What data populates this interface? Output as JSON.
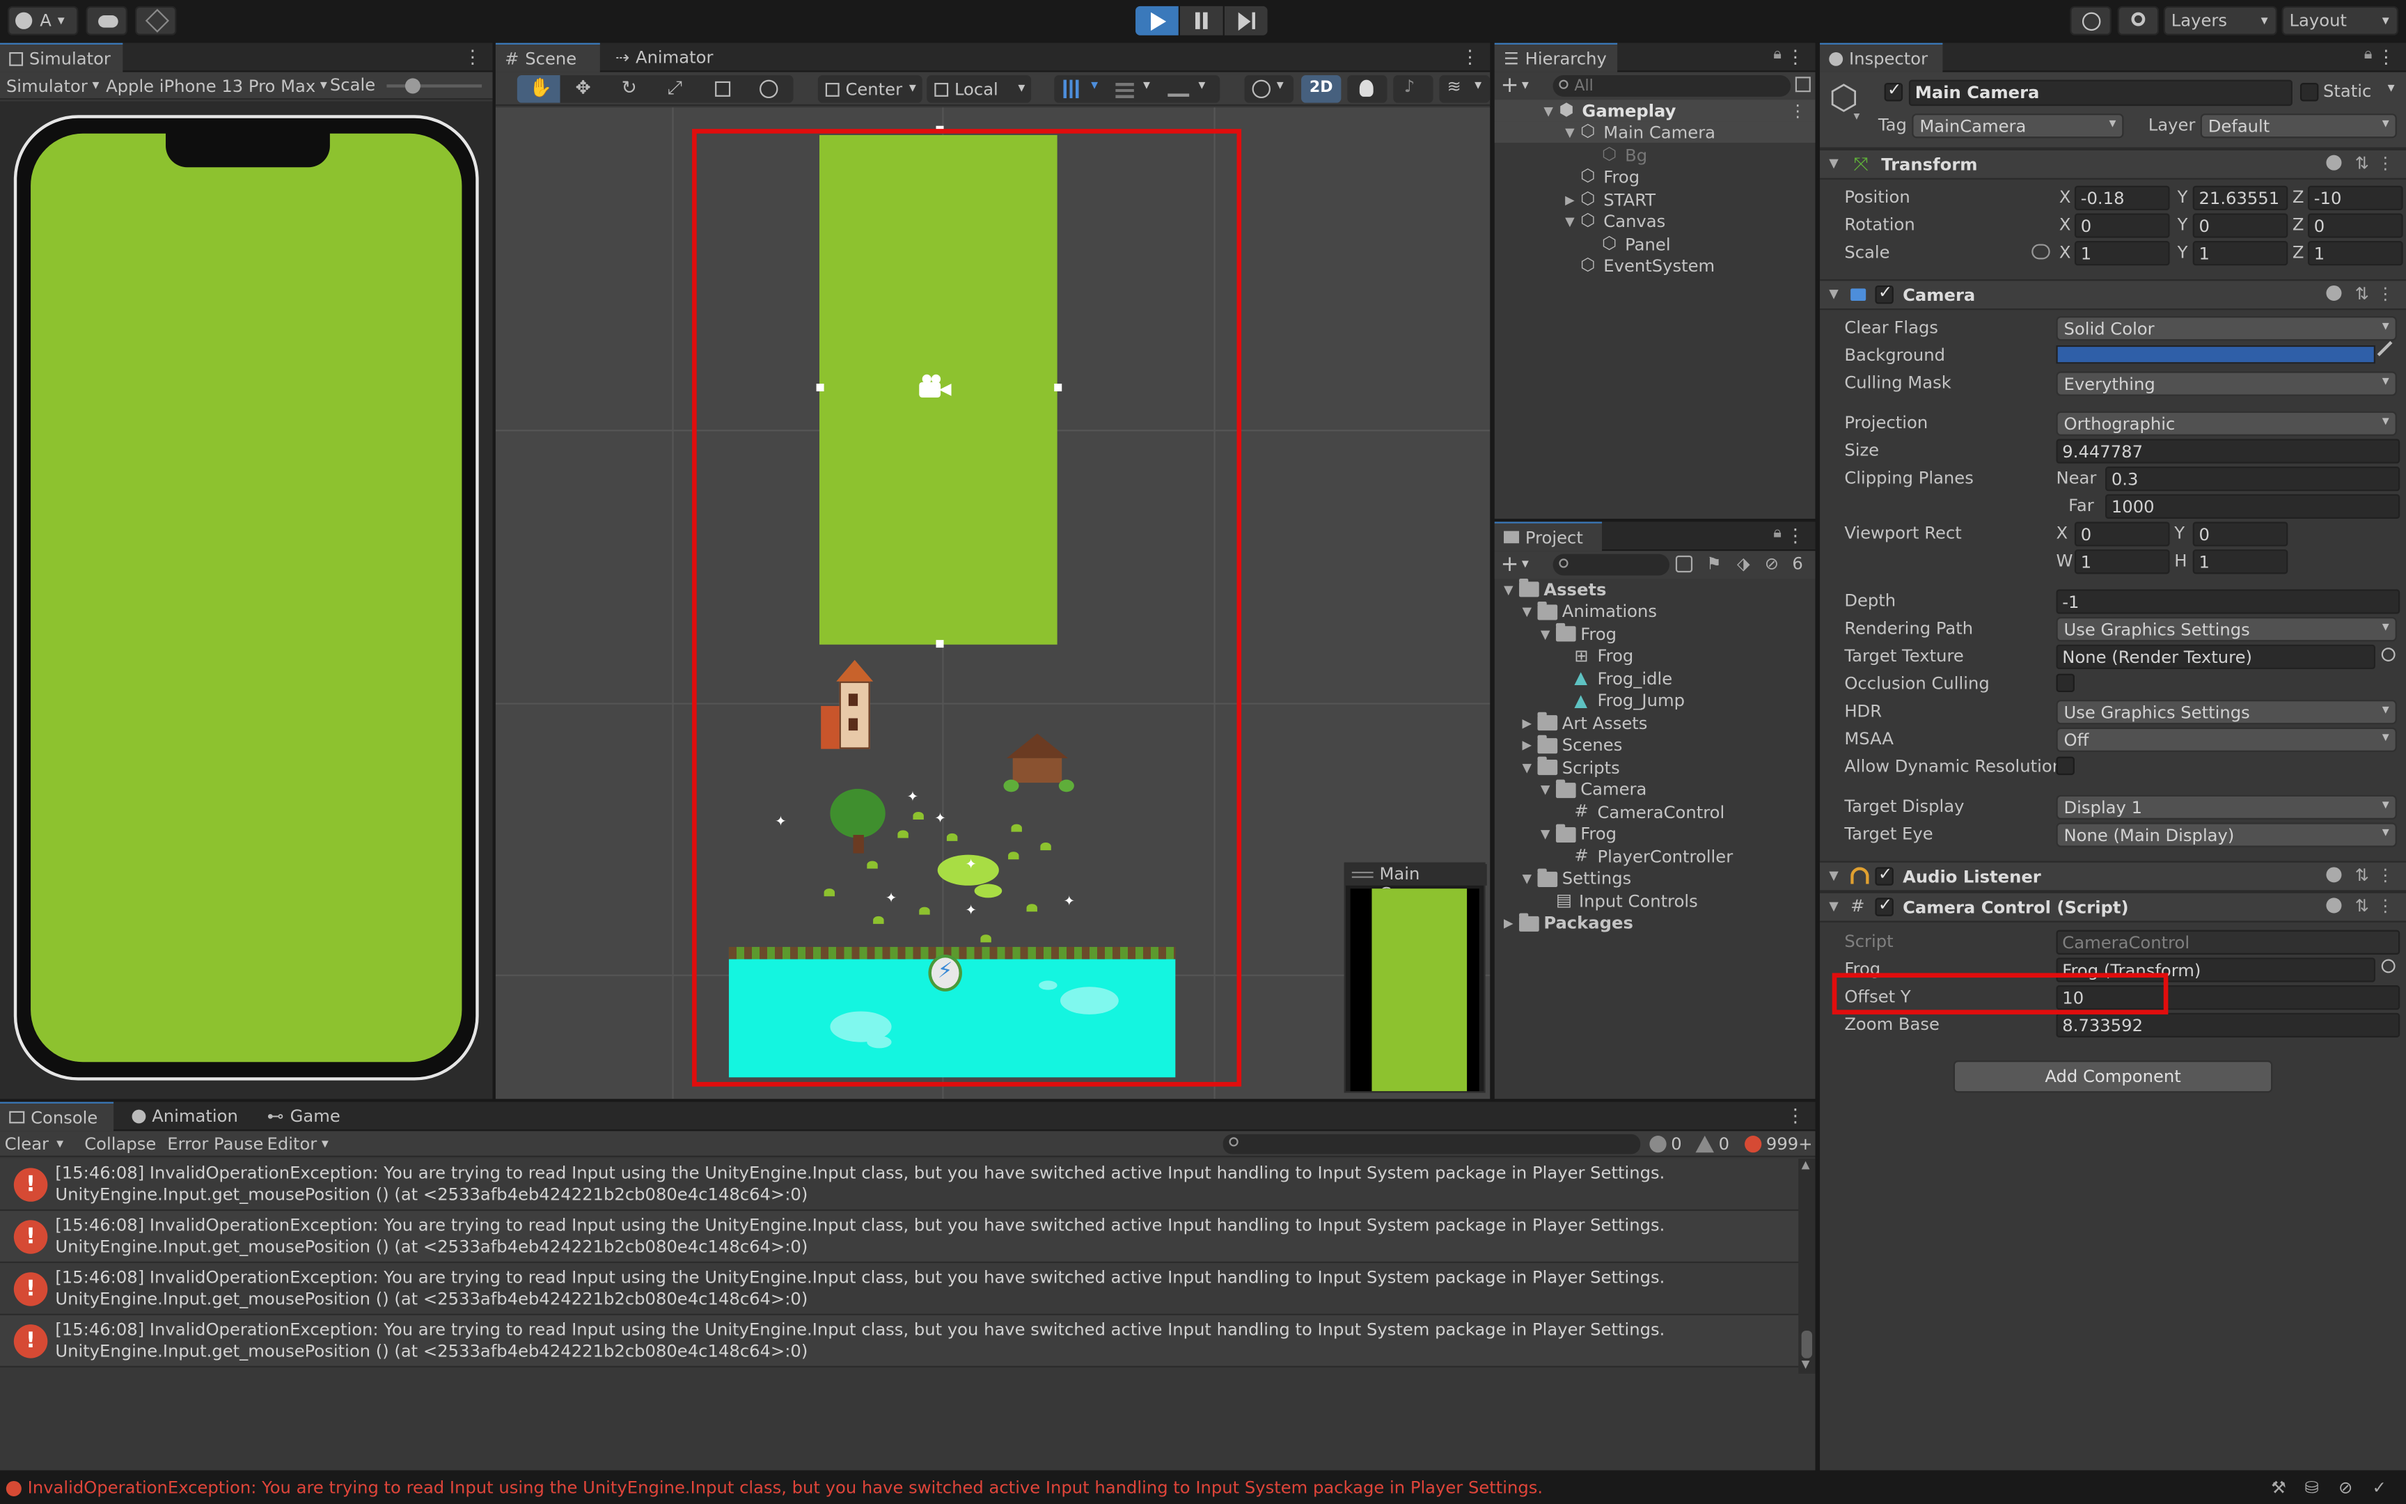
{
  "toolbar": {
    "account_label": "A",
    "layers_label": "Layers",
    "layout_label": "Layout",
    "colors": {
      "play_active": "#3a79bb"
    }
  },
  "simulator": {
    "tab_label": "Simulator",
    "mode_dropdown": "Simulator",
    "device_dropdown": "Apple iPhone 13 Pro Max",
    "scale_label": "Scale",
    "screen_color": "#8dc22f"
  },
  "scene": {
    "tabs": [
      "Scene",
      "Animator"
    ],
    "pivot_dropdown": "Center",
    "space_dropdown": "Local",
    "mode_2d_label": "2D",
    "camera_preview_title": "Main Camera"
  },
  "hierarchy": {
    "tab_label": "Hierarchy",
    "search_placeholder": "All",
    "items": [
      {
        "label": "Gameplay",
        "depth": 0,
        "expanded": true
      },
      {
        "label": "Main Camera",
        "depth": 1,
        "expanded": true,
        "selected": true
      },
      {
        "label": "Bg",
        "depth": 2,
        "disabled": true
      },
      {
        "label": "Frog",
        "depth": 1
      },
      {
        "label": "START",
        "depth": 1,
        "collapsed": true
      },
      {
        "label": "Canvas",
        "depth": 1,
        "expanded": true
      },
      {
        "label": "Panel",
        "depth": 2
      },
      {
        "label": "EventSystem",
        "depth": 1
      }
    ]
  },
  "project": {
    "tab_label": "Project",
    "hidden_count": "6",
    "items": [
      {
        "label": "Assets",
        "depth": 0,
        "type": "folder",
        "expanded": true,
        "bold": true
      },
      {
        "label": "Animations",
        "depth": 1,
        "type": "folder",
        "expanded": true
      },
      {
        "label": "Frog",
        "depth": 2,
        "type": "folder",
        "expanded": true
      },
      {
        "label": "Frog",
        "depth": 3,
        "type": "controller"
      },
      {
        "label": "Frog_idle",
        "depth": 3,
        "type": "anim"
      },
      {
        "label": "Frog_Jump",
        "depth": 3,
        "type": "anim"
      },
      {
        "label": "Art Assets",
        "depth": 1,
        "type": "folder"
      },
      {
        "label": "Scenes",
        "depth": 1,
        "type": "folder"
      },
      {
        "label": "Scripts",
        "depth": 1,
        "type": "folder",
        "expanded": true
      },
      {
        "label": "Camera",
        "depth": 2,
        "type": "folder",
        "expanded": true
      },
      {
        "label": "CameraControl",
        "depth": 3,
        "type": "script"
      },
      {
        "label": "Frog",
        "depth": 2,
        "type": "folder",
        "expanded": true
      },
      {
        "label": "PlayerController",
        "depth": 3,
        "type": "script"
      },
      {
        "label": "Settings",
        "depth": 1,
        "type": "folder",
        "expanded": true
      },
      {
        "label": "Input Controls",
        "depth": 2,
        "type": "asset"
      },
      {
        "label": "Packages",
        "depth": 0,
        "type": "folder",
        "bold": true
      }
    ]
  },
  "inspector": {
    "tab_label": "Inspector",
    "object_name": "Main Camera",
    "static_label": "Static",
    "tag_label": "Tag",
    "tag_value": "MainCamera",
    "layer_label": "Layer",
    "layer_value": "Default",
    "transform": {
      "title": "Transform",
      "position_label": "Position",
      "rotation_label": "Rotation",
      "scale_label": "Scale",
      "position": {
        "x": "-0.18",
        "y": "21.63551",
        "z": "-10"
      },
      "rotation": {
        "x": "0",
        "y": "0",
        "z": "0"
      },
      "scale": {
        "x": "1",
        "y": "1",
        "z": "1"
      }
    },
    "axes": {
      "x": "X",
      "y": "Y",
      "z": "Z",
      "w": "W",
      "h": "H"
    },
    "camera": {
      "title": "Camera",
      "clear_flags_label": "Clear Flags",
      "clear_flags": "Solid Color",
      "background_label": "Background",
      "background_color": "#2f5fa8",
      "culling_mask_label": "Culling Mask",
      "culling_mask": "Everything",
      "projection_label": "Projection",
      "projection": "Orthographic",
      "size_label": "Size",
      "size": "9.447787",
      "clipping_label": "Clipping Planes",
      "near_label": "Near",
      "near": "0.3",
      "far_label": "Far",
      "far": "1000",
      "viewport_label": "Viewport Rect",
      "viewport": {
        "x": "0",
        "y": "0",
        "w": "1",
        "h": "1"
      },
      "depth_label": "Depth",
      "depth": "-1",
      "rendering_path_label": "Rendering Path",
      "rendering_path": "Use Graphics Settings",
      "target_texture_label": "Target Texture",
      "target_texture": "None (Render Texture)",
      "occlusion_label": "Occlusion Culling",
      "hdr_label": "HDR",
      "hdr": "Use Graphics Settings",
      "msaa_label": "MSAA",
      "msaa": "Off",
      "dynres_label": "Allow Dynamic Resolution",
      "target_display_label": "Target Display",
      "target_display": "Display 1",
      "target_eye_label": "Target Eye",
      "target_eye": "None (Main Display)"
    },
    "audio_listener": {
      "title": "Audio Listener"
    },
    "camera_control": {
      "title": "Camera Control (Script)",
      "script_label": "Script",
      "script_value": "CameraControl",
      "frog_label": "Frog",
      "frog_value": "Frog (Transform)",
      "offset_y_label": "Offset Y",
      "offset_y": "10",
      "zoom_base_label": "Zoom Base",
      "zoom_base": "8.733592"
    },
    "add_component": "Add Component"
  },
  "bottom": {
    "tabs": [
      "Console",
      "Animation",
      "Game"
    ],
    "clear": "Clear",
    "collapse": "Collapse",
    "error_pause": "Error Pause",
    "editor": "Editor",
    "counts": {
      "log": "0",
      "warn": "0",
      "error": "999+"
    },
    "messages": [
      {
        "line1": "[15:46:08] InvalidOperationException: You are trying to read Input using the UnityEngine.Input class, but you have switched active Input handling to Input System package in Player Settings.",
        "line2": "UnityEngine.Input.get_mousePosition () (at <2533afb4eb424221b2cb080e4c148c64>:0)"
      },
      {
        "line1": "[15:46:08] InvalidOperationException: You are trying to read Input using the UnityEngine.Input class, but you have switched active Input handling to Input System package in Player Settings.",
        "line2": "UnityEngine.Input.get_mousePosition () (at <2533afb4eb424221b2cb080e4c148c64>:0)"
      },
      {
        "line1": "[15:46:08] InvalidOperationException: You are trying to read Input using the UnityEngine.Input class, but you have switched active Input handling to Input System package in Player Settings.",
        "line2": "UnityEngine.Input.get_mousePosition () (at <2533afb4eb424221b2cb080e4c148c64>:0)"
      },
      {
        "line1": "[15:46:08] InvalidOperationException: You are trying to read Input using the UnityEngine.Input class, but you have switched active Input handling to Input System package in Player Settings.",
        "line2": "UnityEngine.Input.get_mousePosition () (at <2533afb4eb424221b2cb080e4c148c64>:0)"
      }
    ],
    "status": "InvalidOperationException: You are trying to read Input using the UnityEngine.Input class, but you have switched active Input handling to Input System package in Player Settings."
  }
}
